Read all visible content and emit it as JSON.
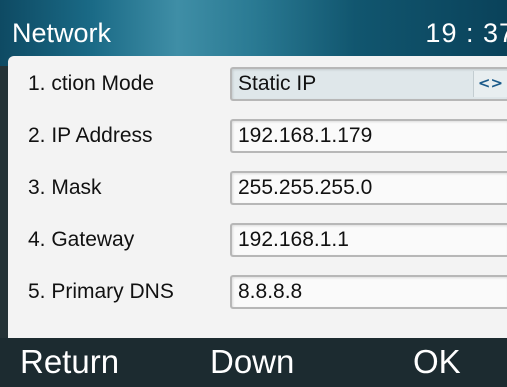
{
  "header": {
    "title": "Network",
    "time": "19 : 37"
  },
  "rows": [
    {
      "label": "1.  ction Mode",
      "value": "Static IP"
    },
    {
      "label": "2.  IP Address",
      "value": "192.168.1.179"
    },
    {
      "label": "3.  Mask",
      "value": "255.255.255.0"
    },
    {
      "label": "4.  Gateway",
      "value": "192.168.1.1"
    },
    {
      "label": "5.  Primary  DNS",
      "value": "8.8.8.8"
    }
  ],
  "switch_glyph": "<>",
  "softkeys": {
    "left": "Return",
    "middle": "Down",
    "right": "OK"
  },
  "colors": {
    "header_accent": "#1a6a86",
    "panel_bg": "#f3f3f3",
    "softkey_bar": "#1c2b30"
  }
}
